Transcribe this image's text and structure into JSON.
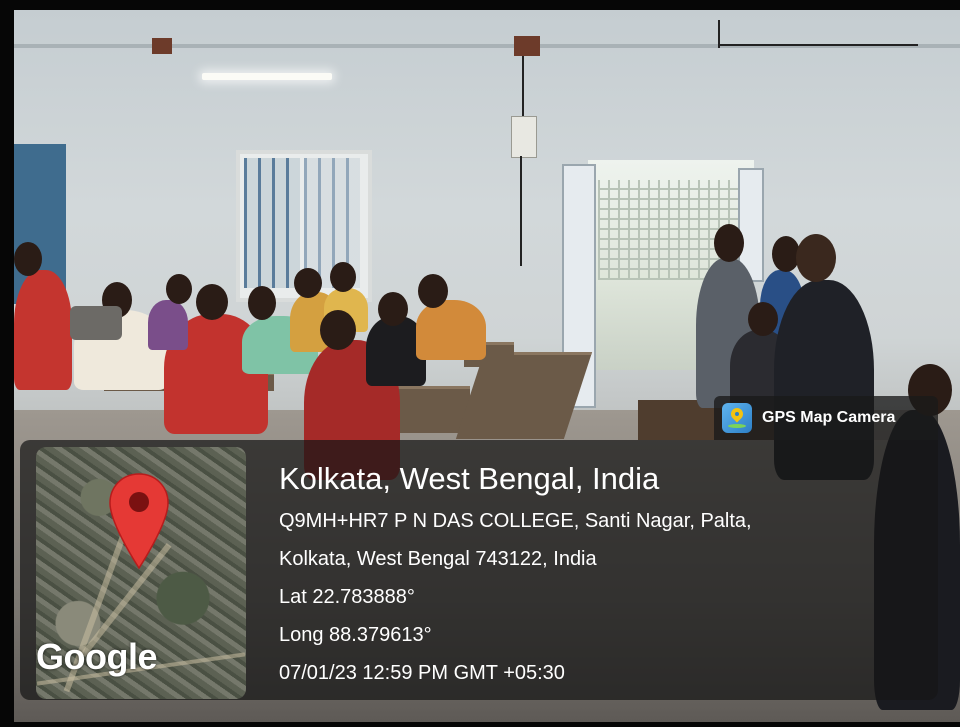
{
  "badge": {
    "icon": "gps-map-camera-icon",
    "label": "GPS Map Camera"
  },
  "map": {
    "provider_wordmark": "Google",
    "pin_icon": "map-pin-icon",
    "pin_color": "#e53935"
  },
  "location": {
    "city_line": "Kolkata, West Bengal, India",
    "address_line_1": "Q9MH+HR7 P N DAS COLLEGE, Santi Nagar, Palta,",
    "address_line_2": "Kolkata, West Bengal 743122, India",
    "latitude": "Lat 22.783888°",
    "longitude": "Long 88.379613°",
    "timestamp": "07/01/23 12:59 PM GMT +05:30"
  }
}
